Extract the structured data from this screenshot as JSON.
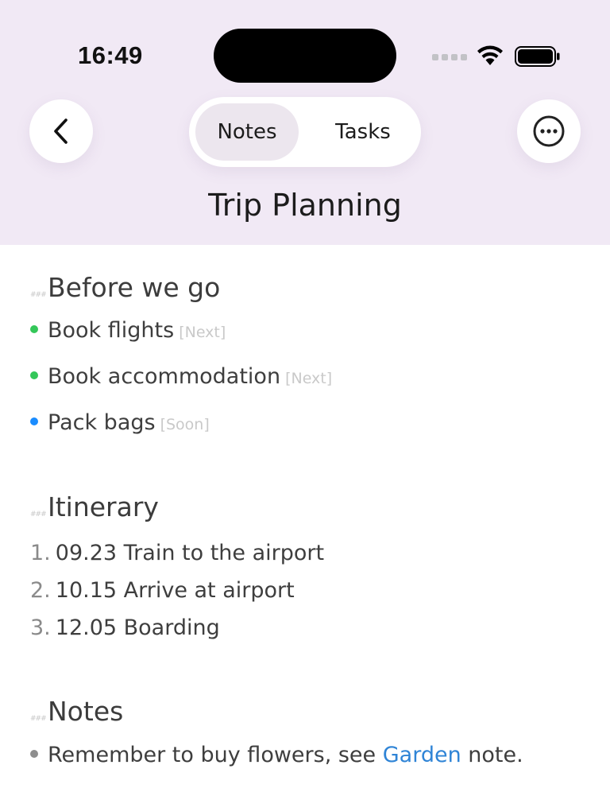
{
  "status_bar": {
    "time": "16:49"
  },
  "nav": {
    "back_icon": "chevron-left-icon",
    "more_icon": "ellipsis-circle-icon",
    "tabs": [
      {
        "label": "Notes",
        "active": true
      },
      {
        "label": "Tasks",
        "active": false
      }
    ]
  },
  "title": "Trip Planning",
  "sections": {
    "before": {
      "hash": "###",
      "heading": "Before we go",
      "items": [
        {
          "text": "Book flights",
          "tag": "[Next]",
          "dot_color": "#34c759"
        },
        {
          "text": "Book accommodation",
          "tag": "[Next]",
          "dot_color": "#34c759"
        },
        {
          "text": "Pack bags",
          "tag": "[Soon]",
          "dot_color": "#1a8cff"
        }
      ]
    },
    "itinerary": {
      "hash": "###",
      "heading": "Itinerary",
      "items": [
        {
          "num": "1.",
          "text": "09.23 Train to the airport"
        },
        {
          "num": "2.",
          "text": "10.15 Arrive at airport"
        },
        {
          "num": "3.",
          "text": "12.05 Boarding"
        }
      ]
    },
    "notes": {
      "hash": "###",
      "heading": "Notes",
      "items": [
        {
          "text_before": "Remember to buy flowers, see ",
          "link": "Garden",
          "text_after": " note.",
          "dot_color": "#8e8e8e"
        }
      ]
    }
  },
  "colors": {
    "header_bg": "#f1e9f5",
    "link": "#2f84d6",
    "green": "#34c759",
    "blue": "#1a8cff"
  }
}
